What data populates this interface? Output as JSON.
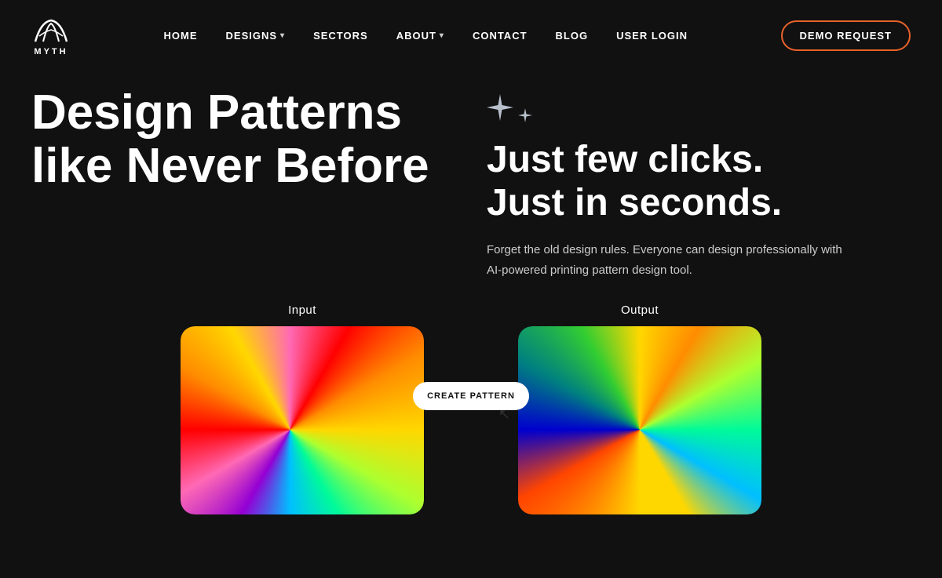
{
  "logo": {
    "text": "MYTH"
  },
  "nav": {
    "items": [
      {
        "label": "HOME",
        "hasDropdown": false
      },
      {
        "label": "DESIGNS",
        "hasDropdown": true
      },
      {
        "label": "SECTORS",
        "hasDropdown": false
      },
      {
        "label": "ABOUT",
        "hasDropdown": true
      },
      {
        "label": "CONTACT",
        "hasDropdown": false
      },
      {
        "label": "BLOG",
        "hasDropdown": false
      },
      {
        "label": "USER LOGIN",
        "hasDropdown": false
      }
    ],
    "demoButton": "DEMO REQUEST"
  },
  "hero": {
    "headline": "Design Patterns like Never Before",
    "taglineHeading": "Just few clicks.\nJust in seconds.",
    "taglineBody": "Forget the old design rules. Everyone can design professionally with AI-powered printing pattern design tool."
  },
  "cards": {
    "inputLabel": "Input",
    "outputLabel": "Output",
    "createButtonLabel": "CREATE PATTERN"
  }
}
